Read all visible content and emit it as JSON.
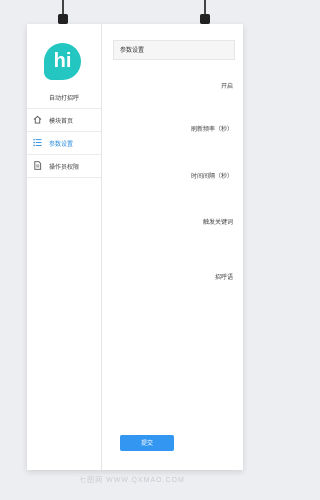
{
  "brand": {
    "logo_text": "hi",
    "name": "自动打招呼",
    "accent": "#23c6c0"
  },
  "sidebar": {
    "items": [
      {
        "label": "模块首页",
        "icon": "home-icon",
        "active": false
      },
      {
        "label": "参数设置",
        "icon": "list-icon",
        "active": true
      },
      {
        "label": "操作员权限",
        "icon": "document-icon",
        "active": false
      }
    ]
  },
  "main": {
    "title": "参数设置",
    "fields": [
      {
        "label": "开启"
      },
      {
        "label": "刷新频率（秒）"
      },
      {
        "label": "时间间隔（秒）"
      },
      {
        "label": "触发关键词"
      },
      {
        "label": "招呼语"
      }
    ],
    "submit_label": "提交",
    "primary_color": "#3396f0"
  },
  "watermark": "七图网 WWW.QXMAO.COM"
}
